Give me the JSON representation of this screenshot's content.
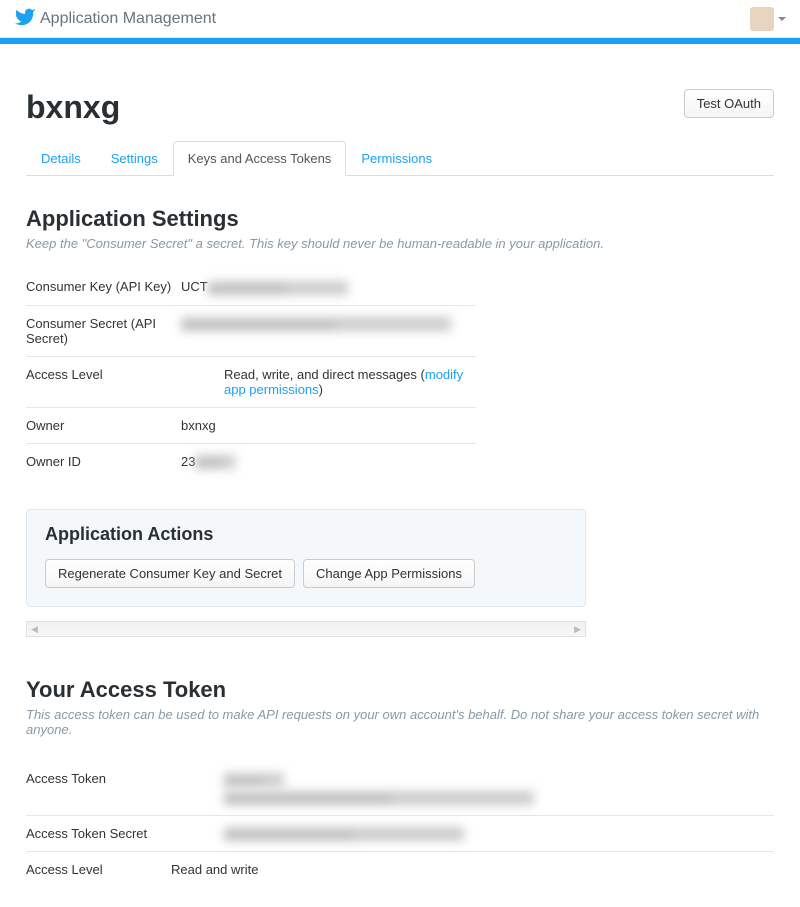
{
  "header": {
    "title": "Application Management"
  },
  "app": {
    "name": "bxnxg",
    "test_oauth_label": "Test OAuth"
  },
  "tabs": [
    {
      "label": "Details"
    },
    {
      "label": "Settings"
    },
    {
      "label": "Keys and Access Tokens"
    },
    {
      "label": "Permissions"
    }
  ],
  "app_settings": {
    "title": "Application Settings",
    "desc": "Keep the \"Consumer Secret\" a secret. This key should never be human-readable in your application.",
    "consumer_key_label": "Consumer Key (API Key)",
    "consumer_key_value": "UCT",
    "consumer_secret_label": "Consumer Secret (API Secret)",
    "access_level_label": "Access Level",
    "access_level_prefix": "Read, write, and direct messages (",
    "access_level_link": "modify app permissions",
    "access_level_suffix": ")",
    "owner_label": "Owner",
    "owner_value": "bxnxg",
    "owner_id_label": "Owner ID",
    "owner_id_prefix": "23"
  },
  "app_actions": {
    "title": "Application Actions",
    "regenerate_label": "Regenerate Consumer Key and Secret",
    "change_perms_label": "Change App Permissions"
  },
  "access_token": {
    "title": "Your Access Token",
    "desc": "This access token can be used to make API requests on your own account's behalf. Do not share your access token secret with anyone.",
    "token_label": "Access Token",
    "secret_label": "Access Token Secret",
    "level_label": "Access Level",
    "level_value": "Read and write"
  }
}
